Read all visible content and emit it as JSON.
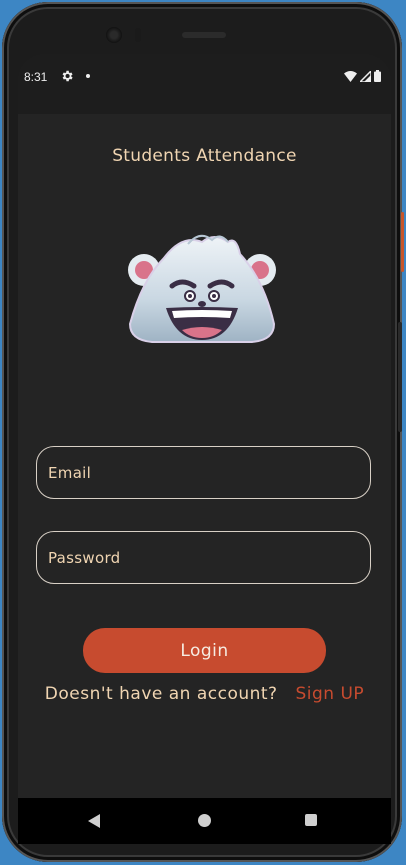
{
  "status_bar": {
    "time": "8:31",
    "icons": [
      "gear-icon",
      "notification-dot-icon",
      "wifi-icon",
      "signal-icon",
      "battery-icon"
    ]
  },
  "app": {
    "title": "Students Attendance",
    "mascot": "yeti-mascot-logo"
  },
  "form": {
    "email_placeholder": "Email",
    "password_placeholder": "Password",
    "login_label": "Login",
    "signup_prompt": "Doesn't have an account?",
    "signup_link": "Sign UP"
  },
  "nav_bar": {
    "icons": [
      "back-icon",
      "home-icon",
      "recents-icon"
    ]
  },
  "colors": {
    "background": "#242424",
    "accent": "#c74b2f",
    "text": "#f0d5b2",
    "field_border": "#d8d0c6"
  }
}
